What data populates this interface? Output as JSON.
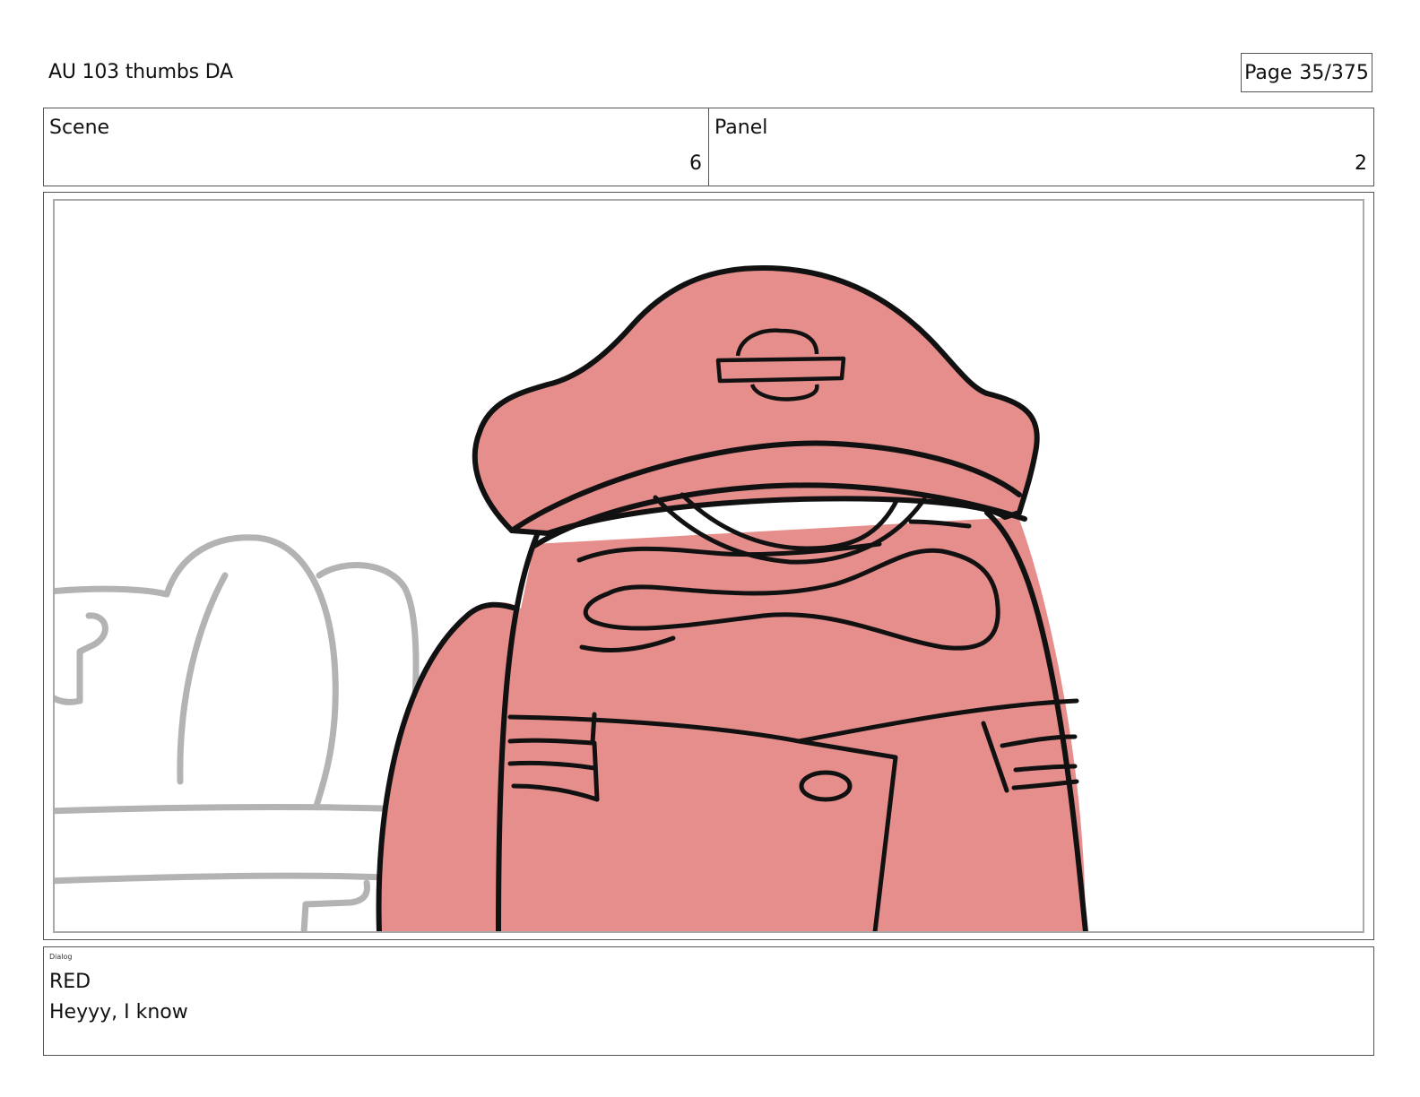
{
  "header": {
    "title": "AU 103 thumbs DA",
    "page_label": "Page",
    "page_number": "35/375"
  },
  "meta": {
    "scene_label": "Scene",
    "scene_value": "6",
    "panel_label": "Panel",
    "panel_value": "2"
  },
  "panel": {
    "character_fill": "#e68e8c",
    "background_line_color": "#b3b3b3",
    "ink_color": "#111111"
  },
  "dialog": {
    "label": "Dialog",
    "speaker": "RED",
    "line": "Heyyy, I know"
  }
}
